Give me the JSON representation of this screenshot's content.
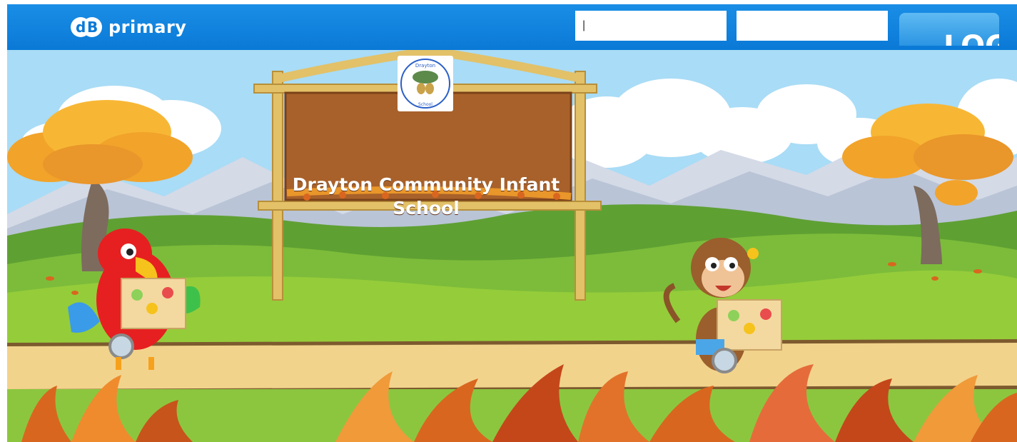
{
  "header": {
    "logo_text": "primary",
    "logo_icon": "db-logo-icon",
    "username_value": "|",
    "password_value": "",
    "login_label": "LOG"
  },
  "school": {
    "name": "Drayton Community Infant School",
    "badge_text": "Drayton Community Infant School"
  },
  "colors": {
    "header_blue": "#0a79d6",
    "sky": "#9fd4f3",
    "sign_wood": "#a8612a"
  }
}
